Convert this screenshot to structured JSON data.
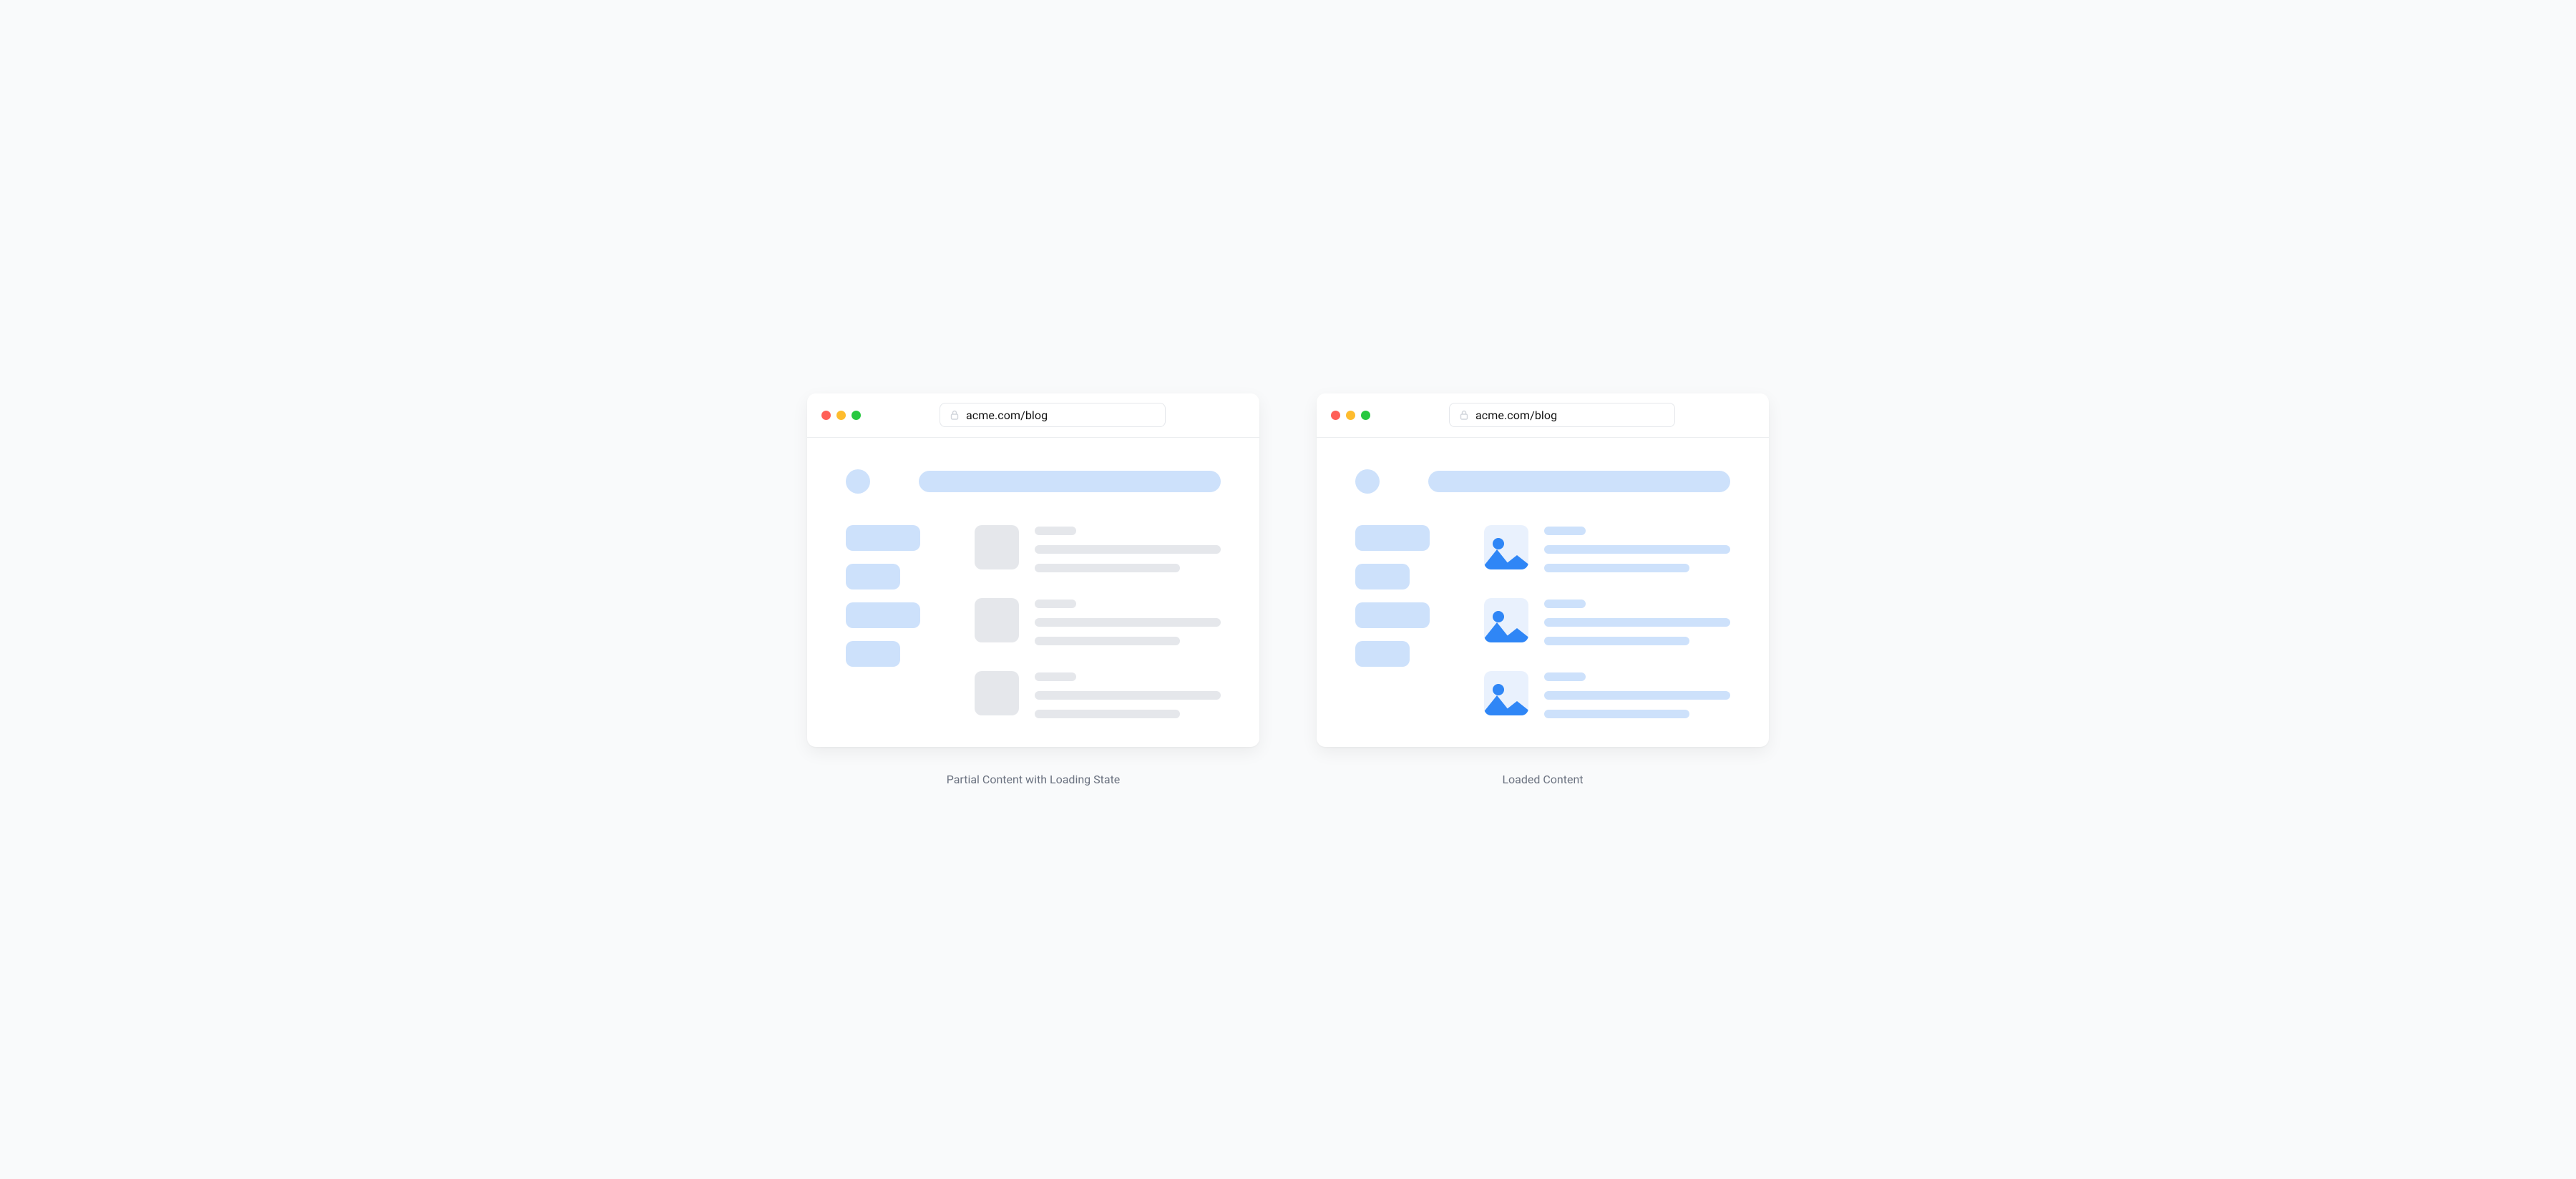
{
  "panels": {
    "left": {
      "url": "acme.com/blog",
      "caption": "Partial Content with Loading State"
    },
    "right": {
      "url": "acme.com/blog",
      "caption": "Loaded Content"
    }
  },
  "colors": {
    "skeleton_gray": "#e5e7eb",
    "placeholder_blue": "#cde1fb",
    "image_accent": "#2f86f6",
    "traffic_red": "#ff5f57",
    "traffic_yellow": "#febc2e",
    "traffic_green": "#28c840"
  }
}
